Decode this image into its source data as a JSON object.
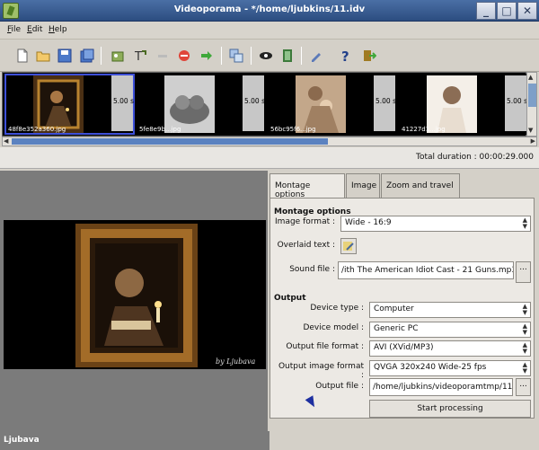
{
  "window": {
    "title": "Videoporama - */home/ljubkins/11.idv",
    "controls": [
      "minimize",
      "maximize",
      "close"
    ]
  },
  "menu": {
    "items": [
      "File",
      "Edit",
      "Help"
    ]
  },
  "toolbar": {
    "icons": [
      "new-icon",
      "open-icon",
      "save-icon",
      "save-as-icon",
      "add-image-icon",
      "add-title-icon",
      "move-up-icon",
      "delete-icon",
      "move-right-icon",
      "duplicate-icon",
      "preview-icon",
      "film-icon",
      "settings-icon",
      "help-icon",
      "exit-icon"
    ]
  },
  "strip": {
    "frames": [
      {
        "duration": "5.00 s",
        "filename": "48f8e352a360.jpg",
        "selected": true
      },
      {
        "duration": "5.00 s",
        "filename": "5fe8e9b...jpg",
        "selected": false
      },
      {
        "duration": "5.00 s",
        "filename": "56bc95f6...jpg",
        "selected": false
      },
      {
        "duration": "5.00 s",
        "filename": "41227d1...jpg",
        "selected": false
      }
    ]
  },
  "status": {
    "total_duration": "Total duration : 00:00:29.000"
  },
  "tabs": {
    "items": [
      "Montage options",
      "Image",
      "Zoom and travel"
    ],
    "active": 0
  },
  "montage": {
    "section_title": "Montage options",
    "image_format_label": "Image format :",
    "image_format_value": "Wide - 16:9",
    "overlaid_text_label": "Overlaid text :",
    "sound_file_label": "Sound file :",
    "sound_file_value": "/ith The American Idiot Cast - 21 Guns.mp3",
    "browse_label": "..."
  },
  "output": {
    "section_title": "Output",
    "device_type_label": "Device type :",
    "device_type_value": "Computer",
    "device_model_label": "Device model :",
    "device_model_value": "Generic PC",
    "output_file_format_label": "Output file format :",
    "output_file_format_value": "AVI (XVid/MP3)",
    "output_image_format_label": "Output image format :",
    "output_image_format_value": "QVGA 320x240 Wide-25 fps",
    "output_file_label": "Output file :",
    "output_file_value": "/home/ljubkins/videoporamtmp/11",
    "browse_label": "...",
    "start_button": "Start processing"
  },
  "preview": {
    "caption": "by Ljubava"
  },
  "watermark": {
    "text": "Ljubava"
  }
}
